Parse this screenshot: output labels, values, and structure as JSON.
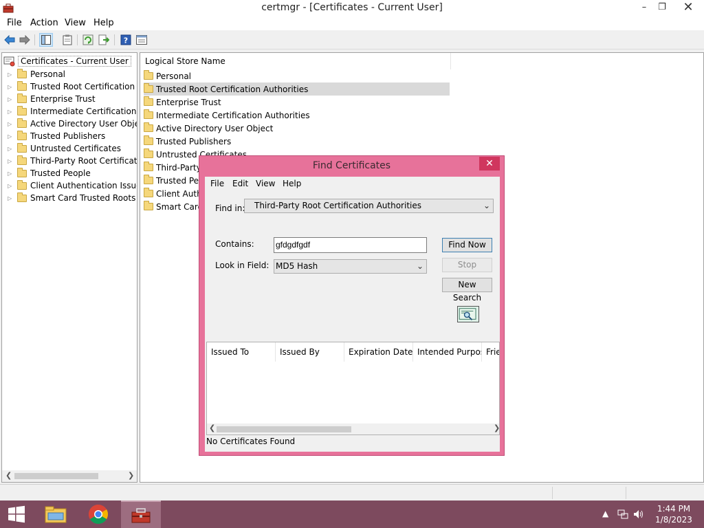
{
  "window": {
    "title": "certmgr - [Certificates - Current User]",
    "min_glyph": "–",
    "max_glyph": "❐",
    "close_glyph": "✕"
  },
  "menu": [
    "File",
    "Action",
    "View",
    "Help"
  ],
  "tree": {
    "root": "Certificates - Current User",
    "items": [
      "Personal",
      "Trusted Root Certification Au",
      "Enterprise Trust",
      "Intermediate Certification Au",
      "Active Directory User Object",
      "Trusted Publishers",
      "Untrusted Certificates",
      "Third-Party Root Certification",
      "Trusted People",
      "Client Authentication Issuers",
      "Smart Card Trusted Roots"
    ]
  },
  "list": {
    "header": "Logical Store Name",
    "items": [
      "Personal",
      "Trusted Root Certification Authorities",
      "Enterprise Trust",
      "Intermediate Certification Authorities",
      "Active Directory User Object",
      "Trusted Publishers",
      "Untrusted Certificates",
      "Third-Party",
      "Trusted Peo",
      "Client Authe",
      "Smart Card"
    ],
    "selected_index": 1
  },
  "dialog": {
    "title": "Find Certificates",
    "close_glyph": "✕",
    "menu": [
      "File",
      "Edit",
      "View",
      "Help"
    ],
    "find_in_label": "Find in:",
    "find_in_value": "Third-Party Root Certification Authorities",
    "contains_label": "Contains:",
    "contains_value": "gfdgdfgdf",
    "look_in_label": "Look in Field:",
    "look_in_value": "MD5 Hash",
    "find_now": "Find Now",
    "stop": "Stop",
    "new_search": "New Search",
    "columns": [
      "Issued To",
      "Issued By",
      "Expiration Date",
      "Intended Purpos...",
      "Frien"
    ],
    "status": "No Certificates Found"
  },
  "taskbar": {
    "time": "1:44 PM",
    "date": "1/8/2023"
  },
  "colors": {
    "dialog_frame": "#e7729a",
    "taskbar": "#7d4a5e",
    "close_red": "#d0365e"
  }
}
